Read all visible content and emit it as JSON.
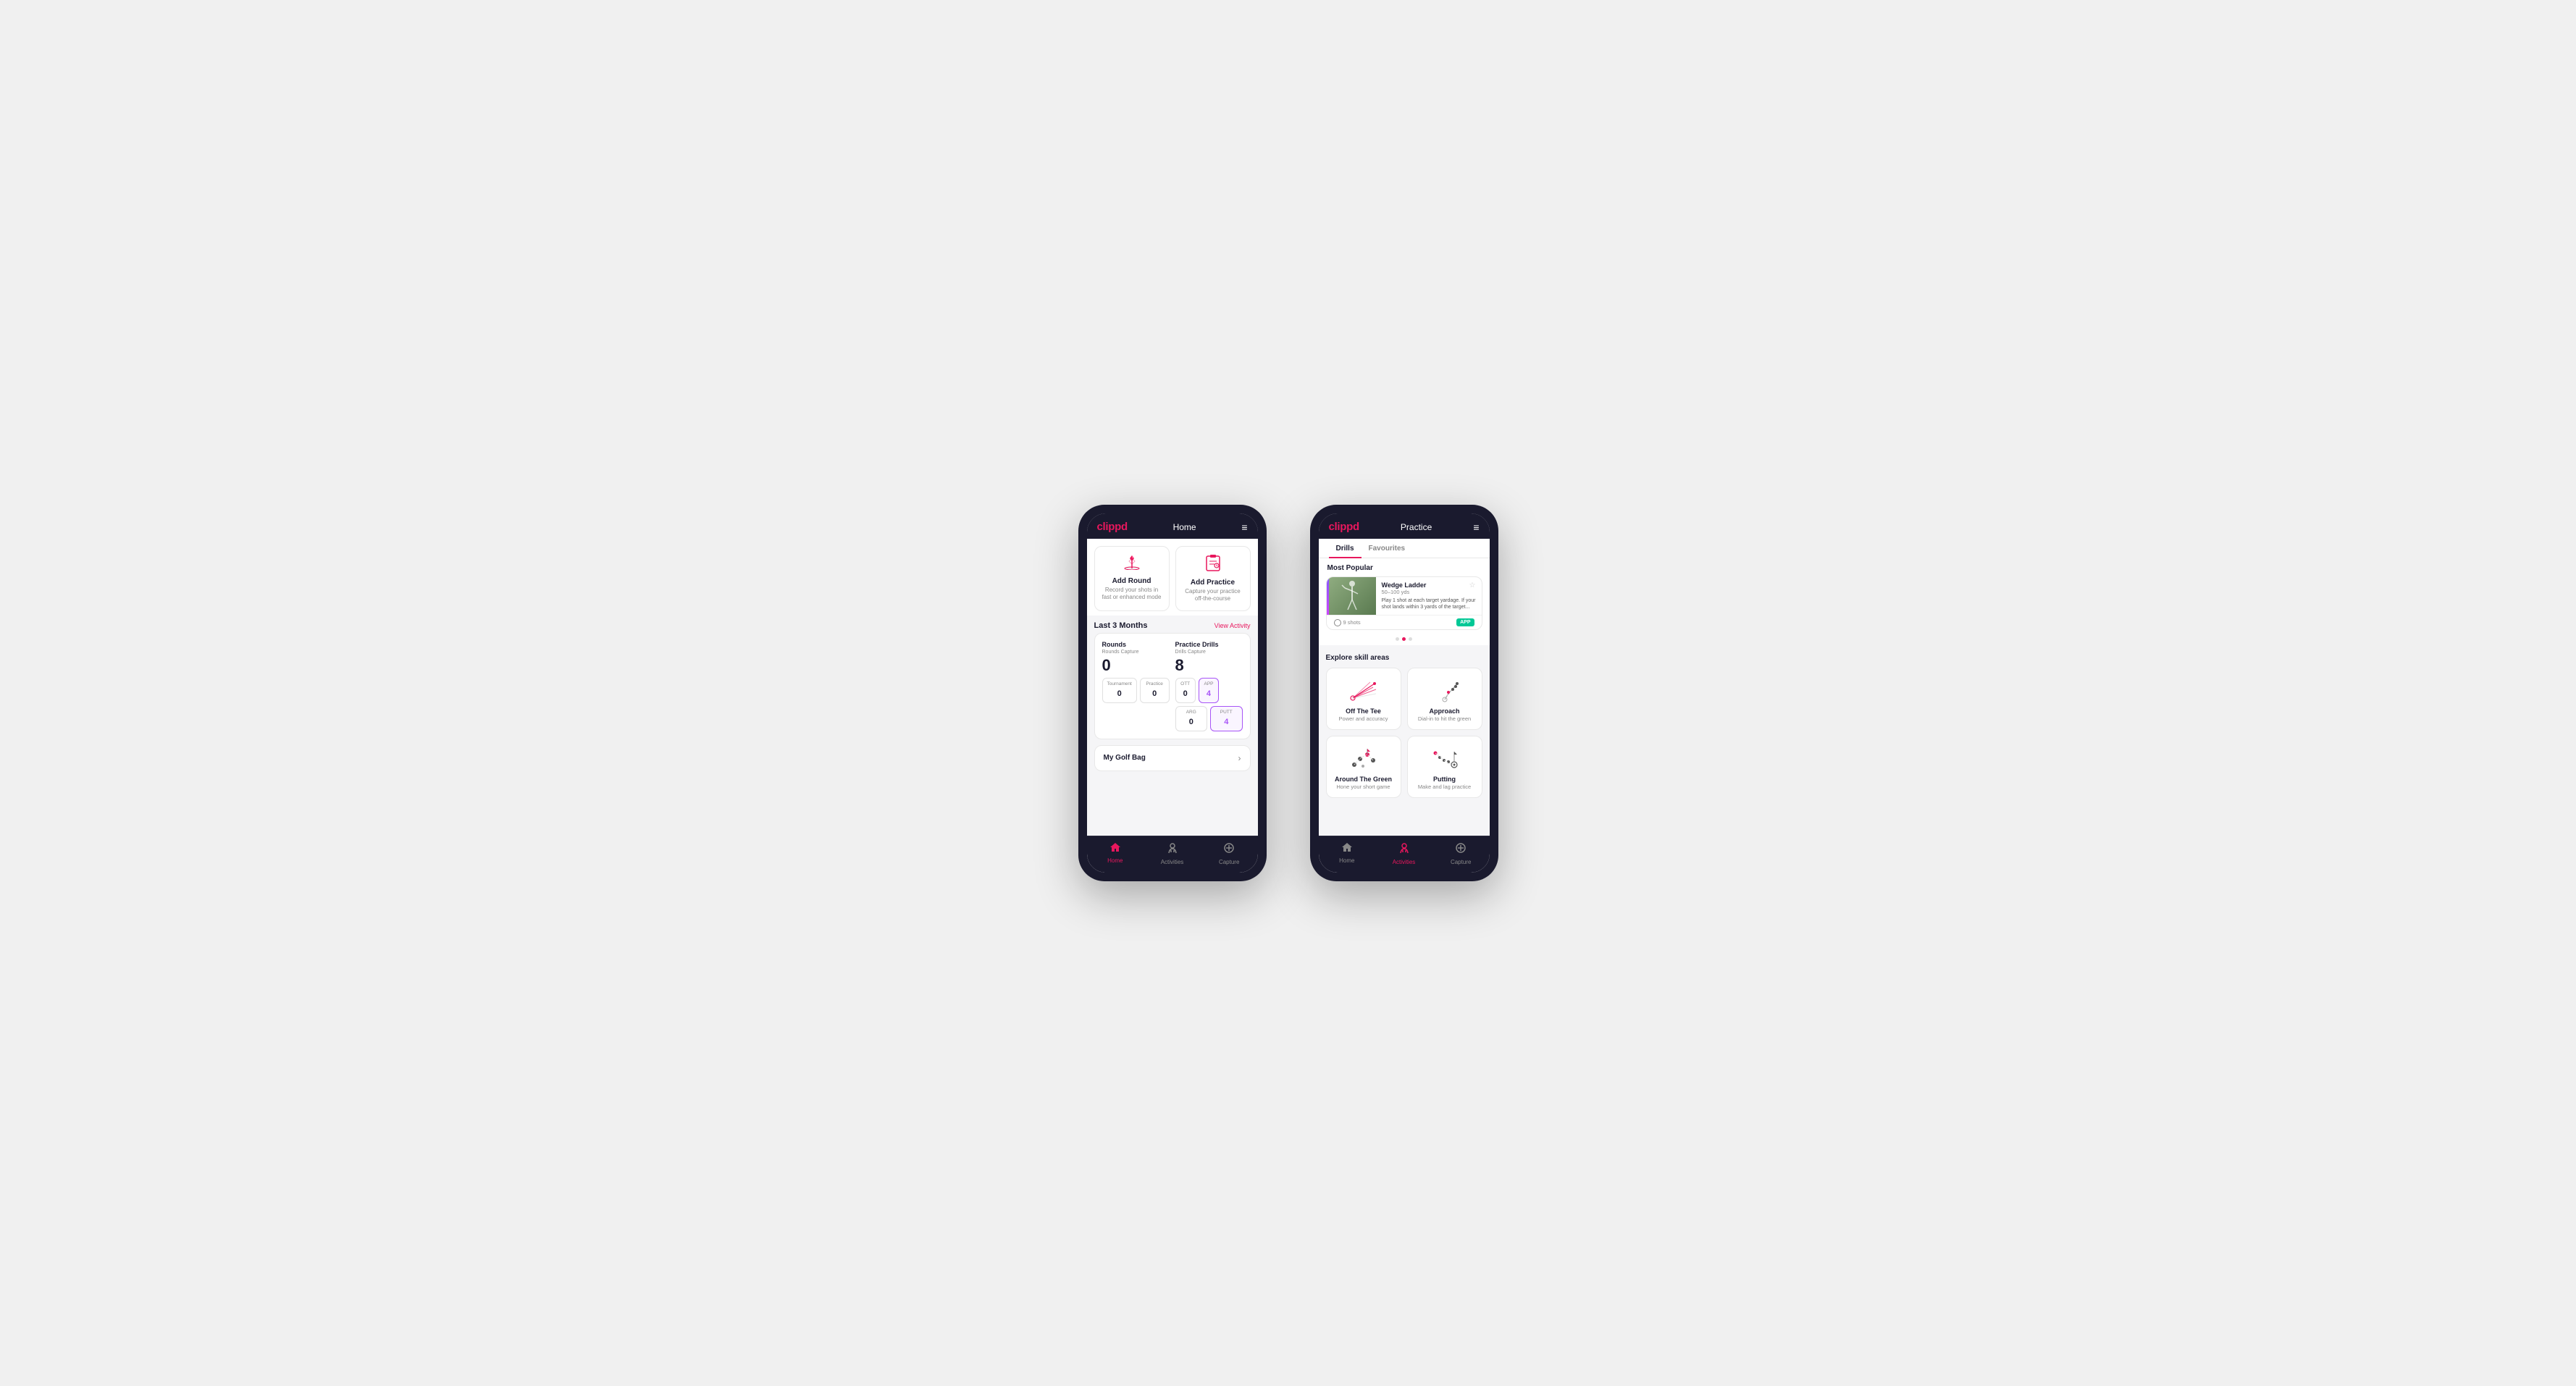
{
  "phone1": {
    "header": {
      "logo": "clippd",
      "title": "Home",
      "menu_icon": "≡"
    },
    "cards": [
      {
        "id": "add-round",
        "icon": "⛳",
        "title": "Add Round",
        "desc": "Record your shots in fast or enhanced mode"
      },
      {
        "id": "add-practice",
        "icon": "📋",
        "title": "Add Practice",
        "desc": "Capture your practice off-the-course"
      }
    ],
    "activity": {
      "section_title": "Last 3 Months",
      "view_link": "View Activity",
      "rounds": {
        "title": "Rounds",
        "captures_label": "Rounds Capture",
        "total": "0",
        "sub": [
          {
            "label": "Tournament",
            "value": "0"
          },
          {
            "label": "Practice",
            "value": "0"
          }
        ]
      },
      "drills": {
        "title": "Practice Drills",
        "captures_label": "Drills Capture",
        "total": "8",
        "sub": [
          {
            "label": "OTT",
            "value": "0"
          },
          {
            "label": "APP",
            "value": "4",
            "highlight": true
          },
          {
            "label": "ARG",
            "value": "0"
          },
          {
            "label": "PUTT",
            "value": "4",
            "highlight": true
          }
        ]
      }
    },
    "golf_bag": {
      "label": "My Golf Bag"
    },
    "nav": [
      {
        "icon": "🏠",
        "label": "Home",
        "active": true
      },
      {
        "icon": "🏌️",
        "label": "Activities",
        "active": false
      },
      {
        "icon": "➕",
        "label": "Capture",
        "active": false
      }
    ]
  },
  "phone2": {
    "header": {
      "logo": "clippd",
      "title": "Practice",
      "menu_icon": "≡"
    },
    "tabs": [
      {
        "label": "Drills",
        "active": true
      },
      {
        "label": "Favourites",
        "active": false
      }
    ],
    "most_popular": {
      "section_title": "Most Popular",
      "drill": {
        "title": "Wedge Ladder",
        "subtitle": "50–100 yds",
        "desc": "Play 1 shot at each target yardage. If your shot lands within 3 yards of the target...",
        "shots": "9 shots",
        "badge": "APP"
      },
      "dots": [
        {
          "active": false
        },
        {
          "active": true
        },
        {
          "active": false
        }
      ]
    },
    "explore": {
      "section_title": "Explore skill areas",
      "skills": [
        {
          "id": "off-the-tee",
          "title": "Off The Tee",
          "desc": "Power and accuracy"
        },
        {
          "id": "approach",
          "title": "Approach",
          "desc": "Dial-in to hit the green"
        },
        {
          "id": "around-the-green",
          "title": "Around The Green",
          "desc": "Hone your short game"
        },
        {
          "id": "putting",
          "title": "Putting",
          "desc": "Make and lag practice"
        }
      ]
    },
    "nav": [
      {
        "icon": "🏠",
        "label": "Home",
        "active": false
      },
      {
        "icon": "🏌️",
        "label": "Activities",
        "active": true
      },
      {
        "icon": "➕",
        "label": "Capture",
        "active": false
      }
    ]
  }
}
